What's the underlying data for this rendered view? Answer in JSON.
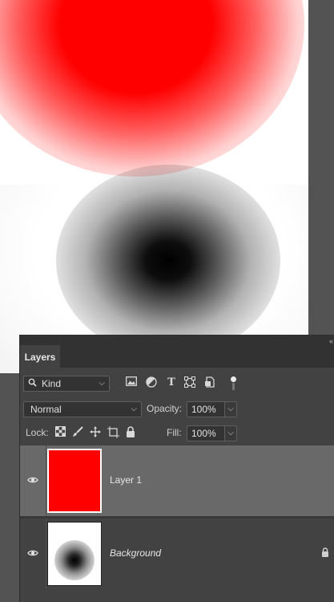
{
  "panel": {
    "tab_label": "Layers",
    "collapse_glyph": "«"
  },
  "filter": {
    "kind_label": "Kind",
    "icons": [
      "image-filter-icon",
      "adjustment-filter-icon",
      "type-filter-icon",
      "shape-filter-icon",
      "smart-object-filter-icon"
    ],
    "toggle_on": true
  },
  "blend": {
    "mode": "Normal",
    "opacity_label": "Opacity:",
    "opacity_value": "100%"
  },
  "lock": {
    "label": "Lock:",
    "icons": [
      "lock-transparent-pixels-icon",
      "lock-image-pixels-icon",
      "lock-position-icon",
      "lock-artboard-icon",
      "lock-all-icon"
    ],
    "fill_label": "Fill:",
    "fill_value": "100%"
  },
  "layers": [
    {
      "name": "Layer 1",
      "visible": true,
      "selected": true,
      "thumbnail_color": "#ff0000",
      "locked": false
    },
    {
      "name": "Background",
      "visible": true,
      "selected": false,
      "locked": true
    }
  ],
  "colors": {
    "panel_bg": "#424242",
    "selected_row": "#696969",
    "canvas_bg": "#535353",
    "red": "#ff0000"
  }
}
